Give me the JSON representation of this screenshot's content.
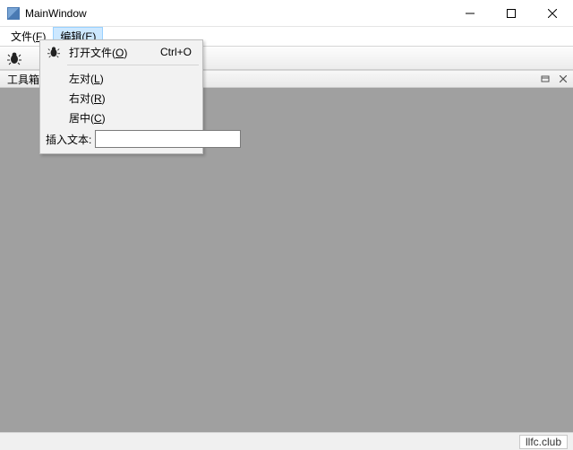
{
  "window": {
    "title": "MainWindow"
  },
  "menubar": {
    "file_label": "文件(",
    "file_mn": "F",
    "file_close": ")",
    "edit_label": "编辑(",
    "edit_mn": "E",
    "edit_close": ")"
  },
  "dropdown": {
    "open_label": "打开文件(",
    "open_mn": "O",
    "open_close": ")",
    "open_shortcut": "Ctrl+O",
    "left_label": "左对(",
    "left_mn": "L",
    "left_close": ")",
    "right_label": "右对(",
    "right_mn": "R",
    "right_close": ")",
    "center_label": "居中(",
    "center_mn": "C",
    "center_close": ")",
    "insert_label": "插入文本:",
    "insert_value": ""
  },
  "dock": {
    "title": "工具箱"
  },
  "status": {
    "text": "llfc.club"
  },
  "icons": {
    "toolbar_bug": "bug-icon",
    "menu_bug": "bug-icon"
  }
}
